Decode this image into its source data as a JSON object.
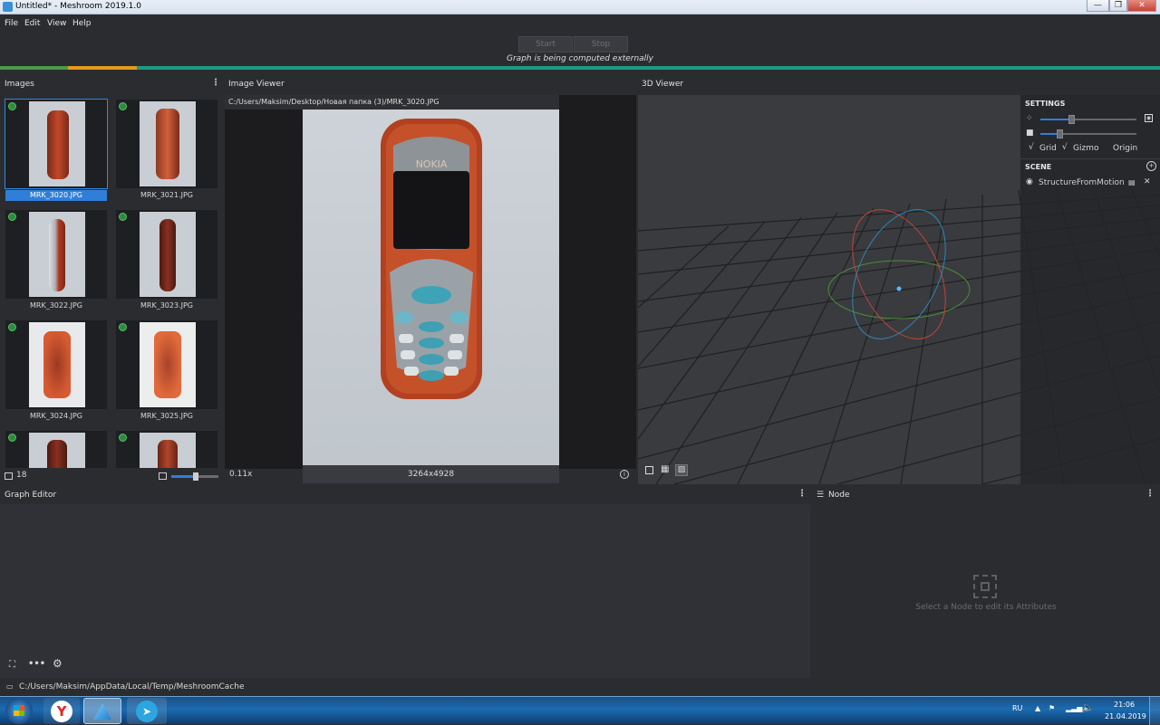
{
  "window": {
    "title": "Untitled* - Meshroom 2019.1.0",
    "min": "—",
    "max": "❐",
    "close": "✕"
  },
  "menu": [
    "File",
    "Edit",
    "View",
    "Help"
  ],
  "run": {
    "start": "Start",
    "stop": "Stop",
    "status": "Graph is being computed externally"
  },
  "images": {
    "title": "Images",
    "count": "18",
    "items": [
      "MRK_3020.JPG",
      "MRK_3021.JPG",
      "MRK_3022.JPG",
      "MRK_3023.JPG",
      "MRK_3024.JPG",
      "MRK_3025.JPG",
      "",
      ""
    ]
  },
  "image_viewer": {
    "title": "Image Viewer",
    "path": "C:/Users/Maksim/Desktop/Новая папка (3)/MRK_3020.JPG",
    "zoom": "0.11x",
    "resolution": "3264x4928",
    "brand": "NOKIA"
  },
  "viewer3d": {
    "title": "3D Viewer",
    "settings_title": "SETTINGS",
    "grid_label": "Grid",
    "gizmo_label": "Gizmo",
    "origin_label": "Origin",
    "check": "√",
    "scene_title": "SCENE",
    "scene_item": "StructureFromMotion",
    "slider1_value": 0.32,
    "slider2_value": 0.18
  },
  "graph_editor": {
    "title": "Graph Editor"
  },
  "node": {
    "title": "Node",
    "hint": "Select a Node to edit its Attributes"
  },
  "status": {
    "cache_path": "C:/Users/Maksim/AppData/Local/Temp/MeshroomCache"
  },
  "taskbar": {
    "lang": "RU",
    "time": "21:06",
    "date": "21.04.2019"
  },
  "colors": {
    "accent": "#2f7fd8",
    "progress_green": "#4d9a48",
    "progress_orange": "#e39a1f",
    "progress_teal": "#1d9a86"
  }
}
